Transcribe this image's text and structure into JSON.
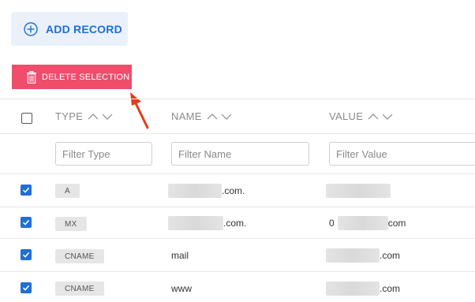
{
  "toolbar": {
    "add_label": "ADD RECORD",
    "add_icon": "plus-circle-icon",
    "delete_label": "DELETE SELECTION",
    "delete_icon": "trash-icon",
    "delete_color": "#ee4d6b",
    "accent_color": "#1f6fd6"
  },
  "table": {
    "headers": {
      "type": "TYPE",
      "name": "NAME",
      "value": "VALUE"
    },
    "filters": {
      "type": "Filter Type",
      "name": "Filter Name",
      "value": "Filter Value"
    },
    "rows": [
      {
        "checked": true,
        "type": "A",
        "name": ".com.",
        "value": ""
      },
      {
        "checked": true,
        "type": "MX",
        "name": ".com.",
        "value_prefix": "0",
        "value_suffix": "com"
      },
      {
        "checked": true,
        "type": "CNAME",
        "name": "mail",
        "value_suffix": ".com"
      },
      {
        "checked": true,
        "type": "CNAME",
        "name": "www",
        "value_suffix": ".com"
      }
    ]
  }
}
